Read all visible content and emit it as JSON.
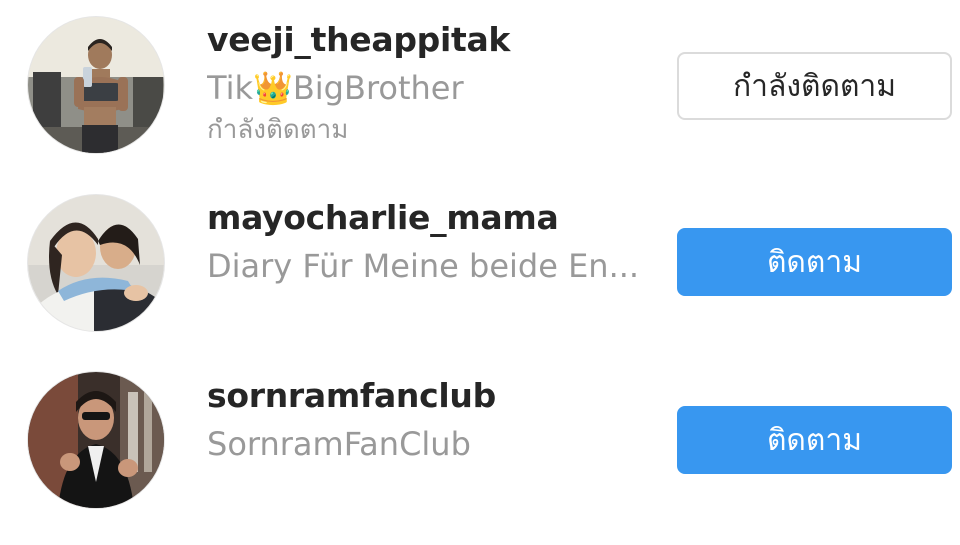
{
  "users": [
    {
      "username": "veeji_theappitak",
      "fullname": "Tik👑BigBrother",
      "subtitle": "กำลังติดตาม",
      "button_label": "กำลังติดตาม",
      "button_state": "following"
    },
    {
      "username": "mayocharlie_mama",
      "fullname": "Diary Für Meine beide En...",
      "subtitle": "",
      "button_label": "ติดตาม",
      "button_state": "follow"
    },
    {
      "username": "sornramfanclub",
      "fullname": "SornramFanClub",
      "subtitle": "",
      "button_label": "ติดตาม",
      "button_state": "follow"
    }
  ],
  "colors": {
    "follow_blue": "#3897f0",
    "text_dark": "#262626",
    "text_muted": "#999999",
    "border_light": "#dbdbdb"
  }
}
